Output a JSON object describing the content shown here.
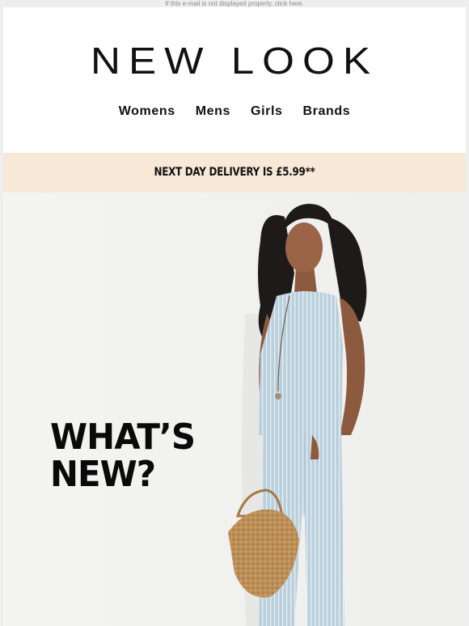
{
  "preheader": {
    "text": "If this e-mail is not displayed properly, click here."
  },
  "brand": {
    "logo_text": "NEW LOOK"
  },
  "nav": {
    "items": [
      {
        "label": "Womens"
      },
      {
        "label": "Mens"
      },
      {
        "label": "Girls"
      },
      {
        "label": "Brands"
      }
    ]
  },
  "banner": {
    "text": "NEXT DAY DELIVERY IS £5.99**",
    "background": "#f8e8d8"
  },
  "hero": {
    "headline_line1": "WHAT’S",
    "headline_line2": "NEW?"
  }
}
